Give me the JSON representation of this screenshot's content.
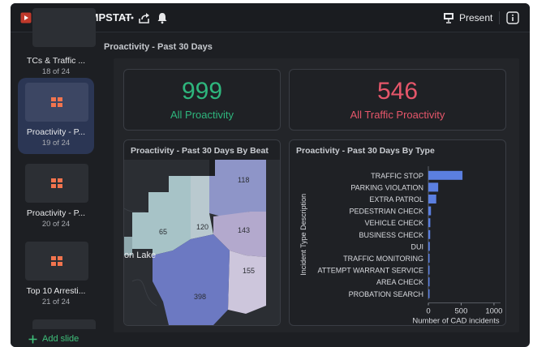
{
  "header": {
    "title": "Weekly COMPSTAT",
    "present_label": "Present"
  },
  "sidebar": {
    "items": [
      {
        "name": "TCs & Traffic ...",
        "count": "18 of 24",
        "active": false
      },
      {
        "name": "Proactivity - P...",
        "count": "19 of 24",
        "active": true
      },
      {
        "name": "Proactivity - P...",
        "count": "20 of 24",
        "active": false
      },
      {
        "name": "Top 10 Arresti...",
        "count": "21 of 24",
        "active": false
      }
    ],
    "add_label": "Add slide"
  },
  "slide": {
    "title": "Proactivity - Past 30 Days",
    "kpis": [
      {
        "value": "999",
        "label": "All Proactivity",
        "color": "#2eb67d"
      },
      {
        "value": "546",
        "label": "All Traffic Proactivity",
        "color": "#e5566a"
      }
    ],
    "map": {
      "title": "Proactivity - Past 30 Days By Beat",
      "place_label": "on Lake",
      "beats": [
        "118",
        "65",
        "120",
        "143",
        "155",
        "398"
      ]
    }
  },
  "chart_data": {
    "type": "bar",
    "orientation": "horizontal",
    "title": "Proactivity - Past 30 Days By Type",
    "ylabel": "Incident Type Description",
    "xlabel": "Number of CAD incidents",
    "xlim": [
      0,
      1100
    ],
    "xticks": [
      0,
      500,
      1000
    ],
    "categories": [
      "TRAFFIC STOP",
      "PARKING VIOLATION",
      "EXTRA PATROL",
      "PEDESTRIAN CHECK",
      "VEHICLE CHECK",
      "BUSINESS CHECK",
      "DUI",
      "TRAFFIC MONITORING",
      "ATTEMPT WARRANT SERVICE",
      "AREA CHECK",
      "PROBATION SEARCH"
    ],
    "values": [
      520,
      150,
      120,
      40,
      30,
      28,
      22,
      15,
      10,
      8,
      6
    ],
    "bar_color": "#5b7fe0"
  }
}
